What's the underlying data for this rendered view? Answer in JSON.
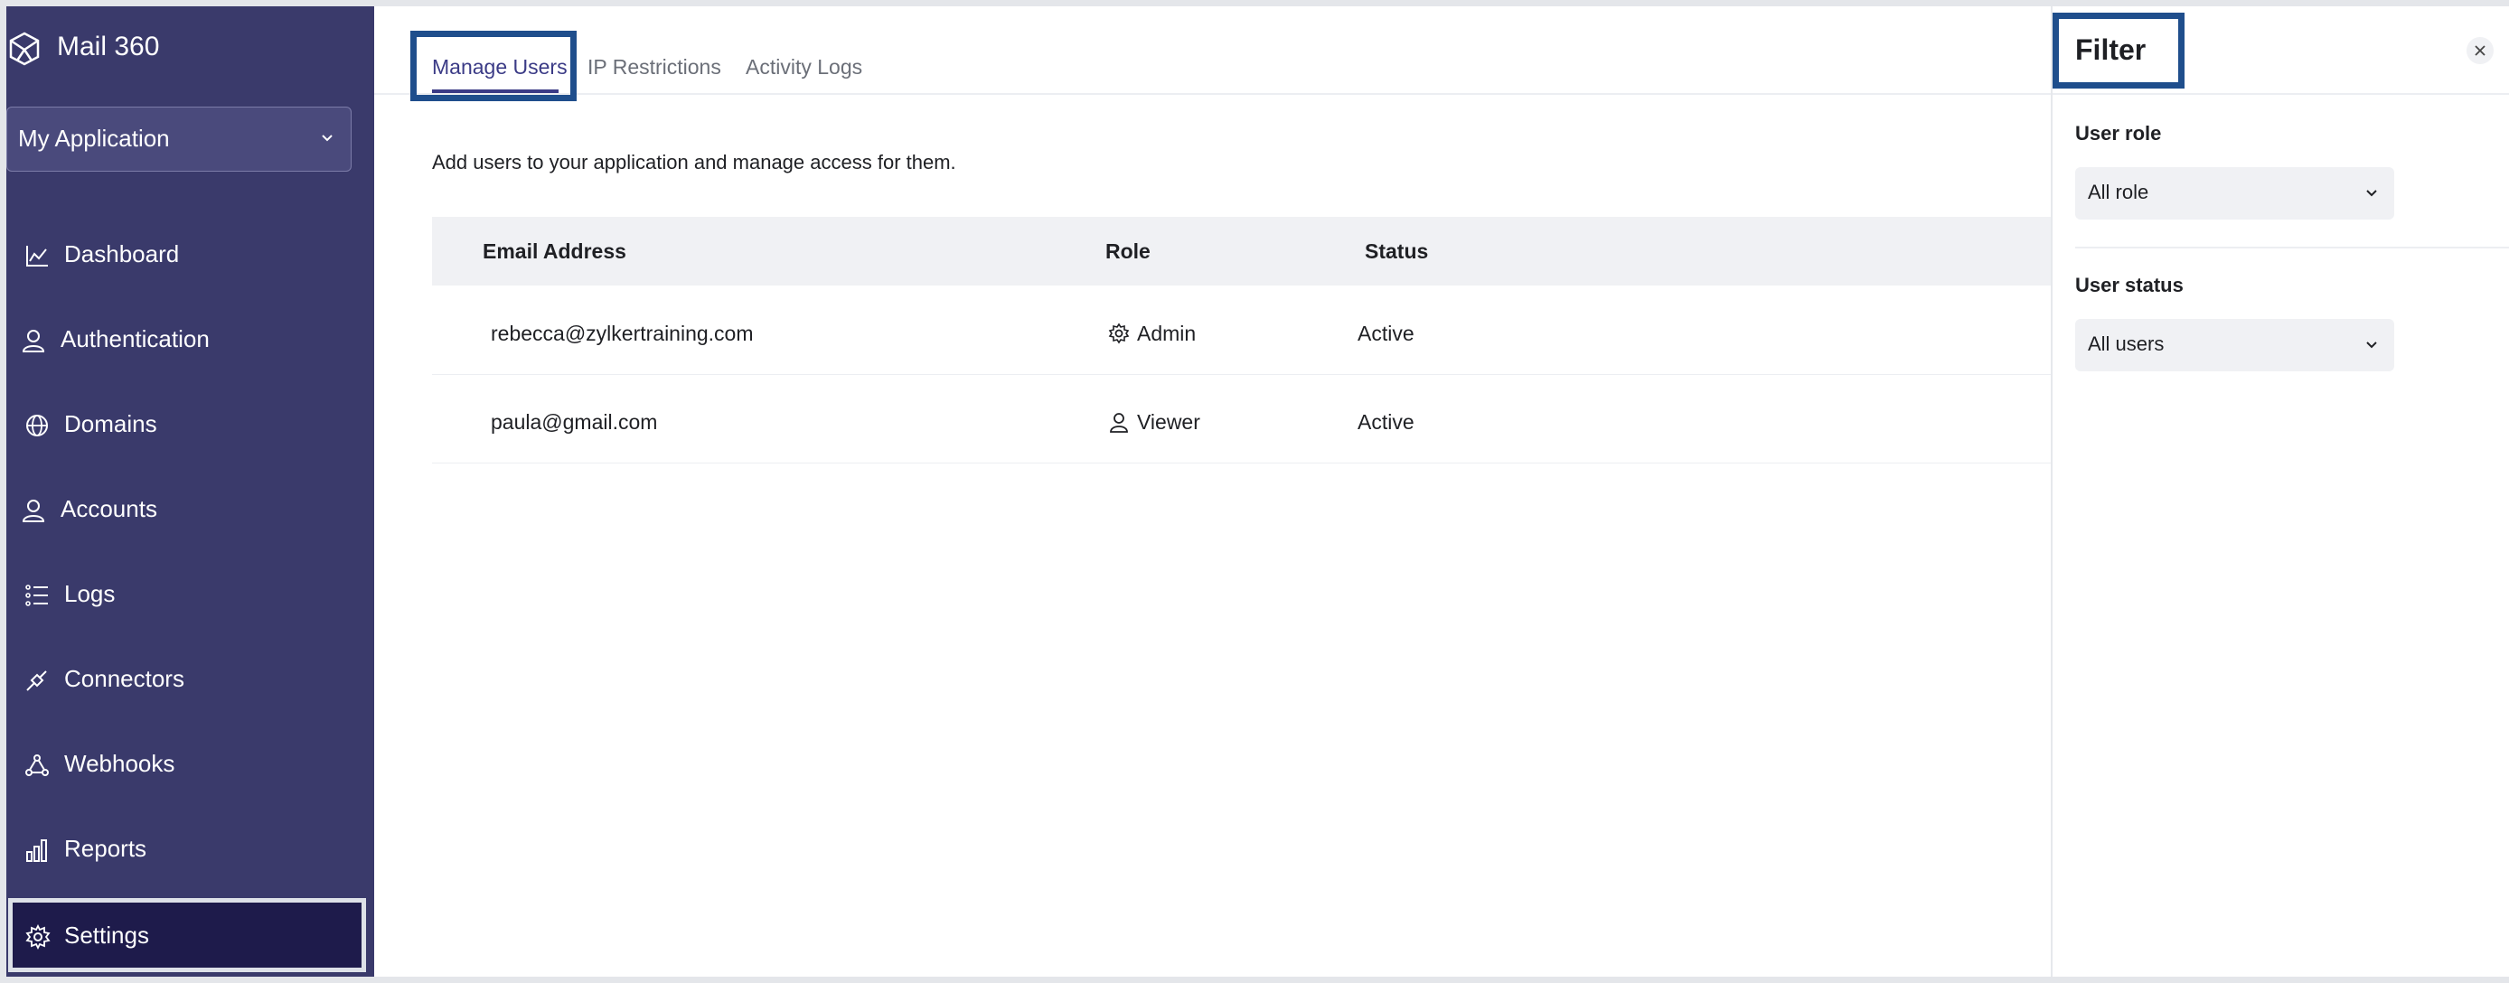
{
  "app": {
    "name": "Mail 360",
    "logo_icon": "mail360-logo-icon"
  },
  "app_selector": {
    "value": "My Application"
  },
  "sidebar": {
    "items": [
      {
        "label": "Dashboard",
        "icon": "chart-line-icon"
      },
      {
        "label": "Authentication",
        "icon": "user-icon"
      },
      {
        "label": "Domains",
        "icon": "globe-icon"
      },
      {
        "label": "Accounts",
        "icon": "user-icon"
      },
      {
        "label": "Logs",
        "icon": "list-icon"
      },
      {
        "label": "Connectors",
        "icon": "plug-icon"
      },
      {
        "label": "Webhooks",
        "icon": "webhook-icon"
      },
      {
        "label": "Reports",
        "icon": "bar-chart-icon"
      },
      {
        "label": "Settings",
        "icon": "gear-icon",
        "active": true
      }
    ]
  },
  "tabs": [
    {
      "label": "Manage Users",
      "active": true
    },
    {
      "label": "IP Restrictions"
    },
    {
      "label": "Activity Logs"
    }
  ],
  "description": "Add users to your application and manage access for them.",
  "table": {
    "columns": [
      "Email Address",
      "Role",
      "Status"
    ],
    "rows": [
      {
        "email": "rebecca@zylkertraining.com",
        "role": "Admin",
        "role_icon": "gear-icon",
        "status": "Active"
      },
      {
        "email": "paula@gmail.com",
        "role": "Viewer",
        "role_icon": "user-icon",
        "status": "Active"
      }
    ]
  },
  "filter": {
    "title": "Filter",
    "user_role": {
      "label": "User role",
      "value": "All role"
    },
    "user_status": {
      "label": "User status",
      "value": "All users"
    }
  },
  "colors": {
    "sidebar_bg": "#3a3a6b",
    "sidebar_active_bg": "#1e1b4b",
    "accent": "#3b3b86",
    "highlight_border": "#1f4e8c"
  }
}
